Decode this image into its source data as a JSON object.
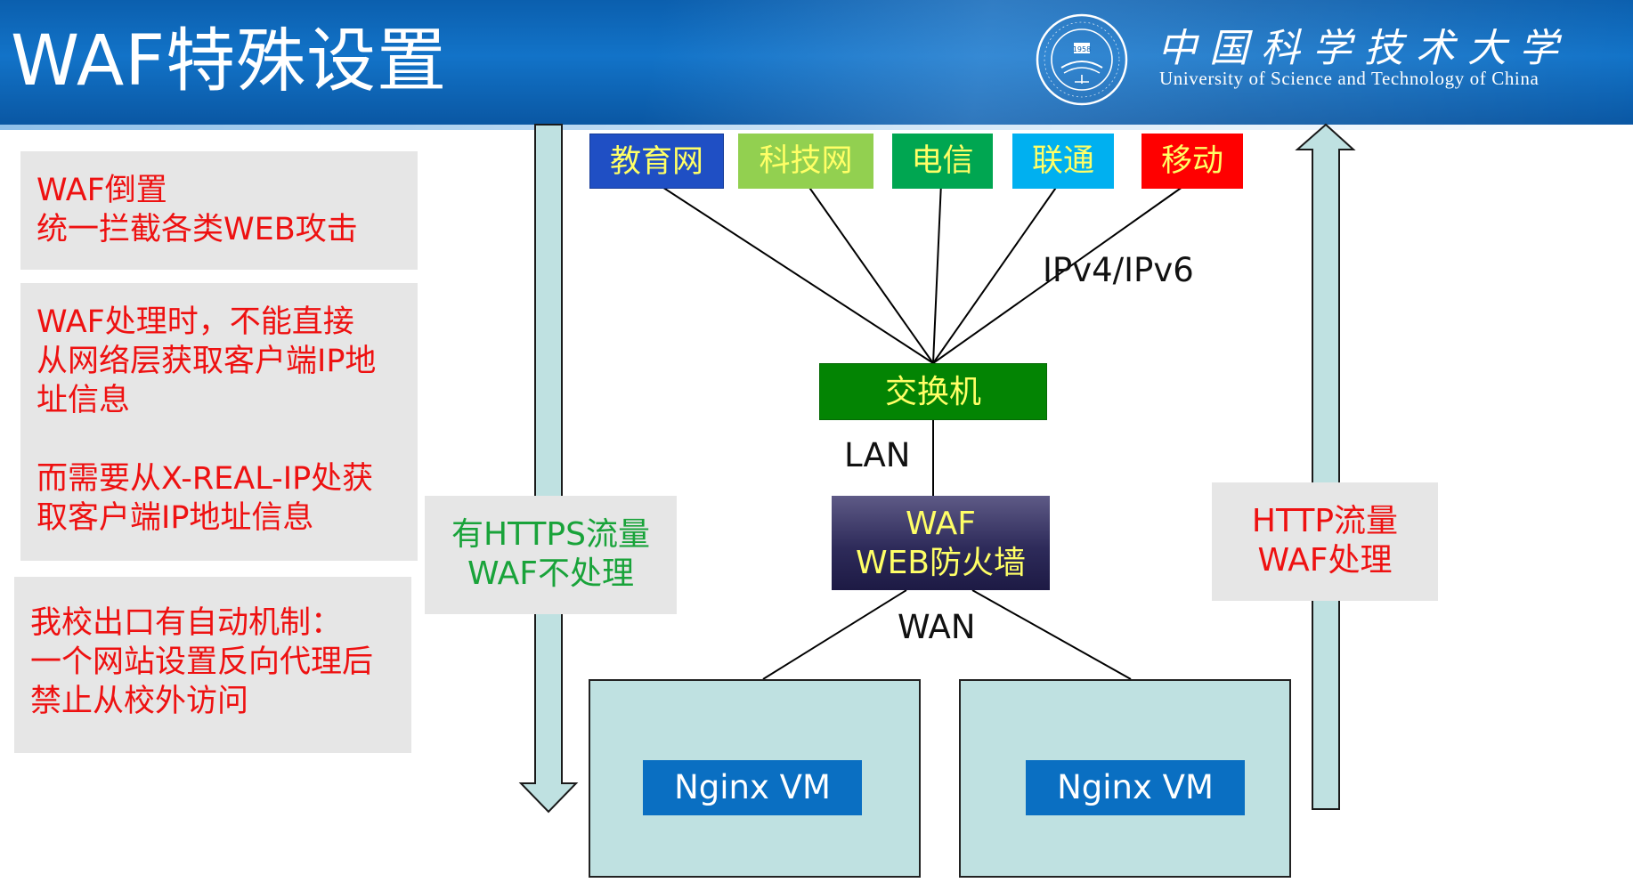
{
  "header": {
    "title": "WAF特殊设置",
    "university_cn": "中国科学技术大学",
    "university_en": "University of Science and Technology of China",
    "seal_year": "1958"
  },
  "notes": [
    {
      "lines": [
        "WAF倒置",
        "统一拦截各类WEB攻击"
      ]
    },
    {
      "lines": [
        "WAF处理时，不能直接",
        "从网络层获取客户端IP地",
        "址信息",
        "",
        "而需要从X-REAL-IP处获",
        "取客户端IP地址信息"
      ]
    },
    {
      "lines": [
        "我校出口有自动机制：",
        "一个网站设置反向代理后",
        "禁止从校外访问"
      ]
    }
  ],
  "https_label": [
    "有HTTPS流量",
    "WAF不处理"
  ],
  "http_label": [
    "HTTP流量",
    "WAF处理"
  ],
  "networks": [
    {
      "label": "教育网",
      "bg": "#1f4fc4",
      "fg": "#ffff66"
    },
    {
      "label": "科技网",
      "bg": "#92d050",
      "fg": "#ffff66"
    },
    {
      "label": "电信",
      "bg": "#00a651",
      "fg": "#ffff66"
    },
    {
      "label": "联通",
      "bg": "#00b0f0",
      "fg": "#ffff66"
    },
    {
      "label": "移动",
      "bg": "#ff0000",
      "fg": "#ffff66"
    }
  ],
  "ip_label": "IPv4/IPv6",
  "switch_label": "交换机",
  "lan_label": "LAN",
  "waf": {
    "line1": "WAF",
    "line2": "WEB防火墙"
  },
  "wan_label": "WAN",
  "vms": [
    "Nginx VM",
    "Nginx VM"
  ],
  "colors": {
    "note_text": "#ee1111",
    "https_text": "#19a33a",
    "http_text": "#ee1111",
    "arrow_fill": "#bfe1e1"
  }
}
